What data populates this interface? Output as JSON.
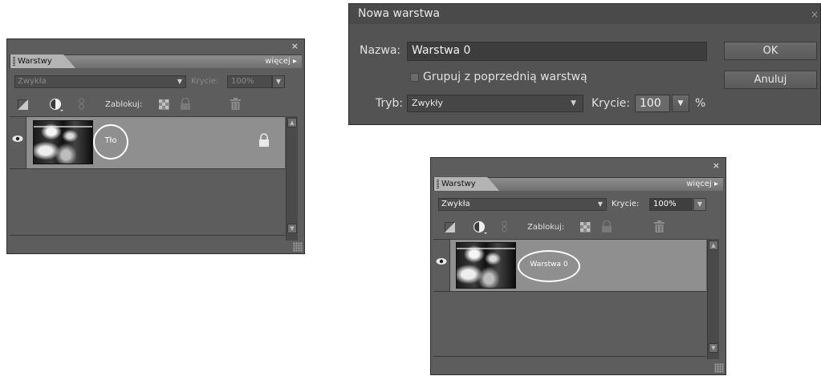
{
  "panel_left": {
    "close": "×",
    "tab": "Warstwy",
    "more": "więcej ▸",
    "mode": "Zwykła",
    "opacity_label": "Krycie:",
    "opacity_value": "100%",
    "lock_label": "Zablokuj:",
    "layer_name": "Tło"
  },
  "dialog": {
    "title": "Nowa warstwa",
    "close": "×",
    "name_label": "Nazwa:",
    "name_value": "Warstwa 0",
    "group_checkbox_label": "Grupuj z poprzednią warstwą",
    "mode_label": "Tryb:",
    "mode_value": "Zwykły",
    "opacity_label": "Krycie:",
    "opacity_value": "100",
    "percent": "%",
    "ok_label": "OK",
    "cancel_label": "Anuluj"
  },
  "panel_right": {
    "close": "×",
    "tab": "Warstwy",
    "more": "więcej ▸",
    "mode": "Zwykła",
    "opacity_label": "Krycie:",
    "opacity_value": "100%",
    "lock_label": "Zablokuj:",
    "layer_name": "Warstwa 0"
  },
  "colors": {
    "panel_bg": "#5d5d5d",
    "layer_selected": "#8f8f8f",
    "dialog_bg": "#535353",
    "highlight_circle": "#ffffff"
  }
}
